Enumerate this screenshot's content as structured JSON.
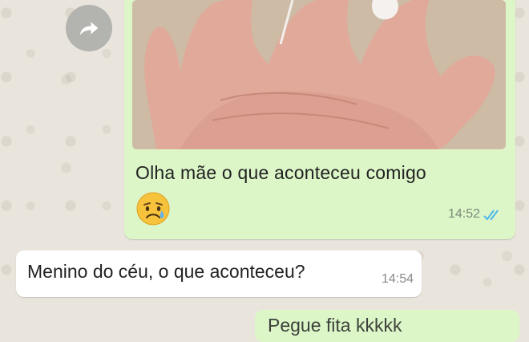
{
  "chat": {
    "outgoing_photo_message": {
      "caption": "Olha mãe o que aconteceu comigo",
      "emoji": "disappointed-relieved-face",
      "time": "14:52",
      "status": "read",
      "status_color": "#4fb6ec"
    },
    "incoming_message": {
      "text": "Menino do céu, o que aconteceu?",
      "time": "14:54"
    },
    "next_outgoing_message": {
      "text": "Pegue fita kkkkk"
    }
  },
  "colors": {
    "outgoing_bubble": "#dcf6c8",
    "incoming_bubble": "#ffffff",
    "wallpaper": "#e9e4dc"
  },
  "icons": {
    "forward": "forward-arrow-icon"
  }
}
